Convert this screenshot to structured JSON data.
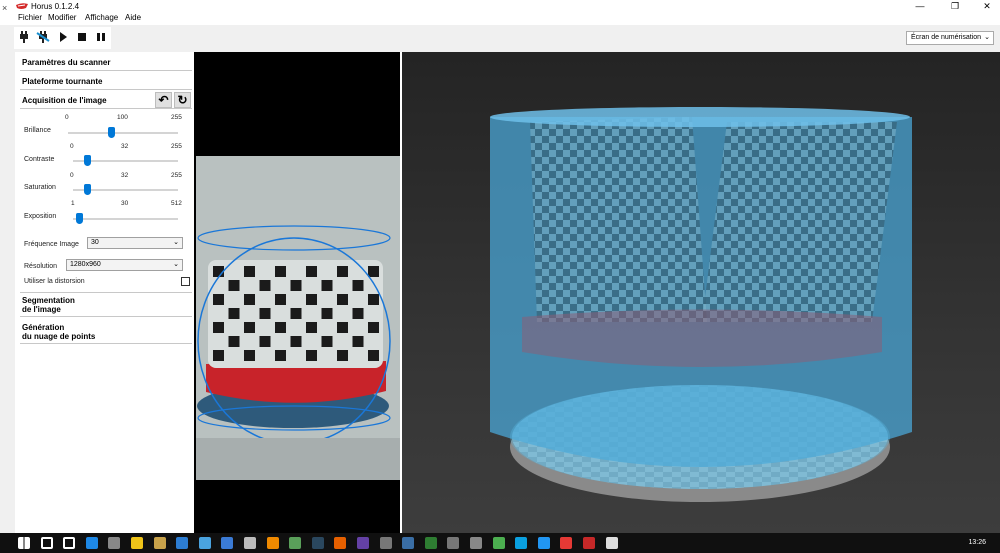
{
  "window": {
    "title": "Horus 0.1.2.4",
    "minimize_glyph": "—",
    "restore_glyph": "❐",
    "close_glyph": "✕",
    "left_close_glyph": "×"
  },
  "menu": [
    "Fichier",
    "Modifier",
    "Affichage",
    "Aide"
  ],
  "toolbar": {
    "icons": [
      "connect-plug-icon",
      "disconnect-plug-icon",
      "play-icon",
      "stop-icon",
      "pause-icon"
    ],
    "view_select": "Écran de numérisation",
    "chevron": "⌄"
  },
  "panel": {
    "sections": {
      "scanner": "Paramètres du scanner",
      "turntable": "Plateforme tournante",
      "acquisition": "Acquisition de l'image",
      "segmentation_1": "Segmentation",
      "segmentation_2": "de l'image",
      "generation_1": "Génération",
      "generation_2": "du nuage de points"
    },
    "undo_glyph": "↶",
    "reset_glyph": "↻",
    "controls": {
      "brightness": {
        "label": "Brillance",
        "min": "0",
        "value": "100",
        "max": "255",
        "fraction": 0.39
      },
      "contrast": {
        "label": "Contraste",
        "min": "0",
        "value": "32",
        "max": "255",
        "fraction": 0.13
      },
      "saturation": {
        "label": "Saturation",
        "min": "0",
        "value": "32",
        "max": "255",
        "fraction": 0.13
      },
      "exposure": {
        "label": "Exposition",
        "min": "1",
        "value": "30",
        "max": "512",
        "fraction": 0.06
      }
    },
    "framerate_label": "Fréquence Image",
    "framerate_value": "30",
    "resolution_label": "Résolution",
    "resolution_value": "1280x960",
    "distortion_label": "Utiliser la distorsion",
    "distortion_checked": false
  },
  "taskbar": {
    "clock": "13:26",
    "icons": [
      "windows-start-icon",
      "search-icon",
      "task-view-icon",
      "edge-icon",
      "store-icon",
      "folder-icon",
      "app-icon",
      "app-icon",
      "app-icon",
      "app-icon",
      "mail-icon",
      "vlc-icon",
      "app-icon",
      "steam-icon",
      "firefox-icon",
      "twitch-icon",
      "app-icon",
      "app-icon",
      "app-icon",
      "app-icon",
      "app-icon",
      "chrome-icon",
      "app-icon",
      "app-icon",
      "app-icon",
      "horus-icon",
      "photos-icon"
    ]
  },
  "colors": {
    "accent": "#0078d7",
    "cloud": "#5ab4dc",
    "turntable_red": "#d42a2a",
    "background_scene": "#2f2f2f"
  }
}
